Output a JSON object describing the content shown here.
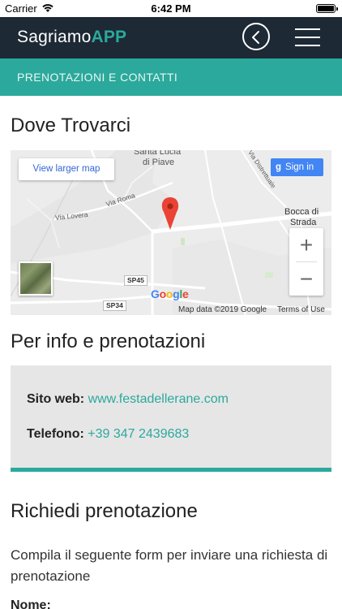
{
  "status_bar": {
    "carrier": "Carrier",
    "time": "6:42 PM"
  },
  "header": {
    "brand_main": "Sagriamo",
    "brand_accent": "APP",
    "back_icon": "chevron-left-circle-icon",
    "menu_icon": "hamburger-menu-icon"
  },
  "section": {
    "title": "PRENOTAZIONI E CONTATTI"
  },
  "location": {
    "heading": "Dove Trovarci",
    "map": {
      "view_larger": "View larger map",
      "sign_in": "Sign in",
      "zoom_in": "+",
      "zoom_out": "−",
      "attribution_data": "Map data ©2019 Google",
      "attribution_terms": "Terms of Use",
      "logo": "Google",
      "places": {
        "town1": "Santa Lucia",
        "town1b": "di Piave",
        "town2": "Bocca di",
        "town2b": "Strada",
        "road_roma": "Via Roma",
        "road_lovera": "Via Lovera",
        "road_distrettuale": "Via Distrettuale",
        "sp45": "SP45",
        "sp34": "SP34"
      }
    }
  },
  "contacts": {
    "heading": "Per info e prenotazioni",
    "website_label": "Sito web:",
    "website_value": "www.festadellerane.com",
    "phone_label": "Telefono:",
    "phone_value": "+39 347 2439683"
  },
  "booking": {
    "heading": "Richiedi prenotazione",
    "description": "Compila il seguente form per inviare una richiesta di prenotazione",
    "name_label": "Nome:"
  },
  "colors": {
    "nav_bg": "#1d2935",
    "accent": "#2ba99c",
    "info_bg": "#e6e6e6"
  }
}
